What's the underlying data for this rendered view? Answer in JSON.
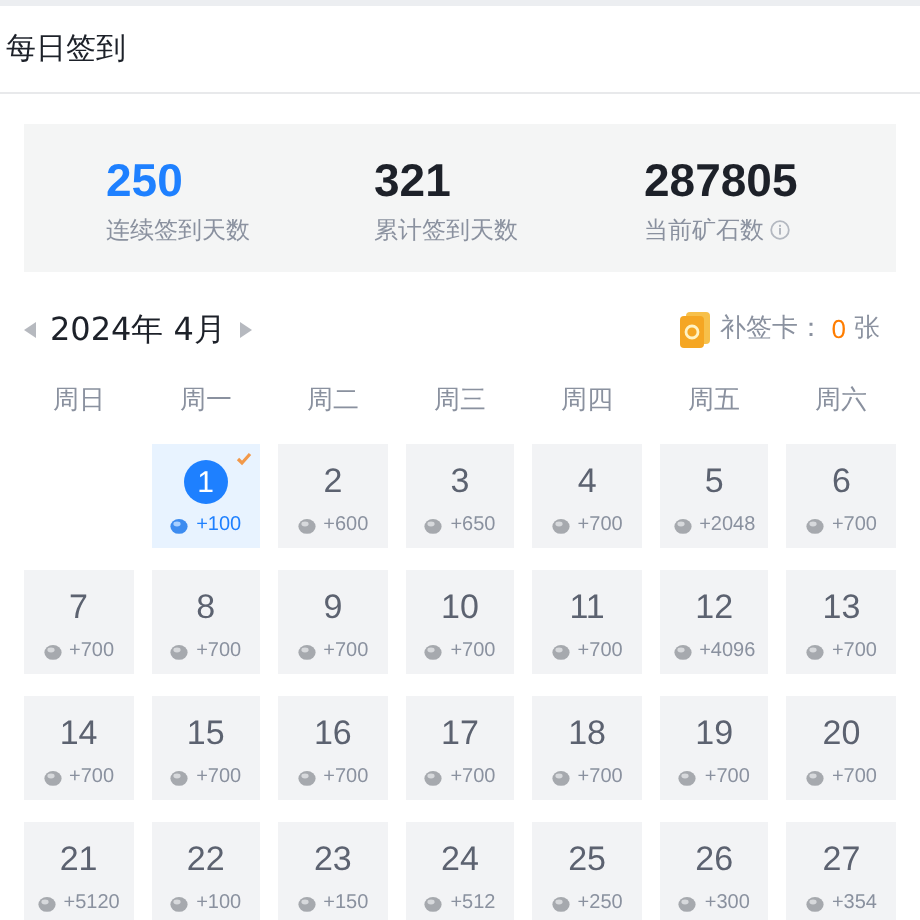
{
  "header": {
    "title": "每日签到"
  },
  "stats": [
    {
      "value": "250",
      "label": "连续签到天数",
      "highlight": true,
      "info": false
    },
    {
      "value": "321",
      "label": "累计签到天数",
      "highlight": false,
      "info": false
    },
    {
      "value": "287805",
      "label": "当前矿石数",
      "highlight": false,
      "info": true
    }
  ],
  "month": {
    "label": "2024年 4月"
  },
  "makeup_card": {
    "label": "补签卡：",
    "count": "0",
    "unit": "张"
  },
  "weekdays": [
    "周日",
    "周一",
    "周二",
    "周三",
    "周四",
    "周五",
    "周六"
  ],
  "weeks": [
    [
      {
        "kind": "blank"
      },
      {
        "kind": "day",
        "day": "1",
        "reward": "+100",
        "selected": true,
        "checked": true
      },
      {
        "kind": "day",
        "day": "2",
        "reward": "+600",
        "selected": false,
        "checked": false
      },
      {
        "kind": "day",
        "day": "3",
        "reward": "+650",
        "selected": false,
        "checked": false
      },
      {
        "kind": "day",
        "day": "4",
        "reward": "+700",
        "selected": false,
        "checked": false
      },
      {
        "kind": "day",
        "day": "5",
        "reward": "+2048",
        "selected": false,
        "checked": false
      },
      {
        "kind": "day",
        "day": "6",
        "reward": "+700",
        "selected": false,
        "checked": false
      }
    ],
    [
      {
        "kind": "day",
        "day": "7",
        "reward": "+700",
        "selected": false,
        "checked": false
      },
      {
        "kind": "day",
        "day": "8",
        "reward": "+700",
        "selected": false,
        "checked": false
      },
      {
        "kind": "day",
        "day": "9",
        "reward": "+700",
        "selected": false,
        "checked": false
      },
      {
        "kind": "day",
        "day": "10",
        "reward": "+700",
        "selected": false,
        "checked": false
      },
      {
        "kind": "day",
        "day": "11",
        "reward": "+700",
        "selected": false,
        "checked": false
      },
      {
        "kind": "day",
        "day": "12",
        "reward": "+4096",
        "selected": false,
        "checked": false
      },
      {
        "kind": "day",
        "day": "13",
        "reward": "+700",
        "selected": false,
        "checked": false
      }
    ],
    [
      {
        "kind": "day",
        "day": "14",
        "reward": "+700",
        "selected": false,
        "checked": false
      },
      {
        "kind": "day",
        "day": "15",
        "reward": "+700",
        "selected": false,
        "checked": false
      },
      {
        "kind": "day",
        "day": "16",
        "reward": "+700",
        "selected": false,
        "checked": false
      },
      {
        "kind": "day",
        "day": "17",
        "reward": "+700",
        "selected": false,
        "checked": false
      },
      {
        "kind": "day",
        "day": "18",
        "reward": "+700",
        "selected": false,
        "checked": false
      },
      {
        "kind": "day",
        "day": "19",
        "reward": "+700",
        "selected": false,
        "checked": false
      },
      {
        "kind": "day",
        "day": "20",
        "reward": "+700",
        "selected": false,
        "checked": false
      }
    ],
    [
      {
        "kind": "day",
        "day": "21",
        "reward": "+5120",
        "selected": false,
        "checked": false
      },
      {
        "kind": "day",
        "day": "22",
        "reward": "+100",
        "selected": false,
        "checked": false
      },
      {
        "kind": "day",
        "day": "23",
        "reward": "+150",
        "selected": false,
        "checked": false
      },
      {
        "kind": "day",
        "day": "24",
        "reward": "+512",
        "selected": false,
        "checked": false
      },
      {
        "kind": "day",
        "day": "25",
        "reward": "+250",
        "selected": false,
        "checked": false
      },
      {
        "kind": "day",
        "day": "26",
        "reward": "+300",
        "selected": false,
        "checked": false
      },
      {
        "kind": "day",
        "day": "27",
        "reward": "+354",
        "selected": false,
        "checked": false
      }
    ]
  ]
}
